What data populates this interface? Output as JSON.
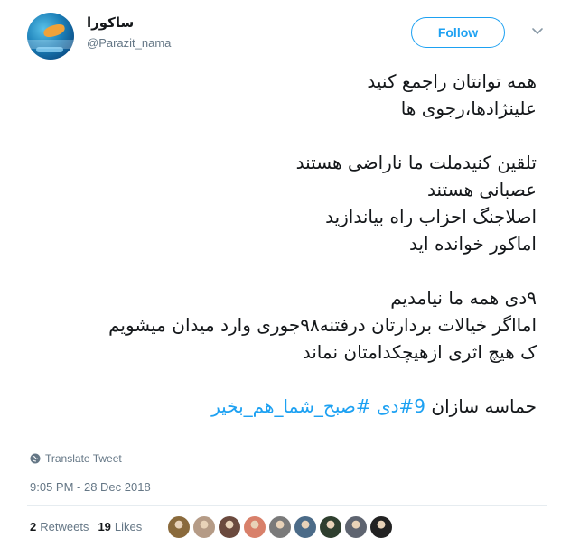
{
  "user": {
    "display_name": "ساکورا",
    "handle": "@Parazit_nama"
  },
  "header": {
    "follow_label": "Follow"
  },
  "tweet": {
    "lines": [
      "همه توانتان راجمع کنید",
      "علینژادها،رجوی ها",
      "",
      "تلقین کنیدملت ما ناراضی هستند",
      " عصبانی هستند",
      "اصلاجنگ احزاب راه بیاندازید",
      "اماکور خوانده اید",
      "",
      "۹دی همه ما نیامدیم",
      "امااگر خیالات بردارتان درفتنه۹۸جوری وارد میدان میشویم",
      "ک هیچ اثری ازهیچکدامتان نماند",
      ""
    ],
    "last_line_text": "حماسه سازان ",
    "hashtag_1": "9#دی",
    "hashtag_2": "#صبح_شما_هم_بخیر",
    "translate_label": "Translate Tweet",
    "timestamp": "9:05 PM - 28 Dec 2018"
  },
  "stats": {
    "retweets_count": "2",
    "retweets_label": "Retweets",
    "likes_count": "19",
    "likes_label": "Likes"
  },
  "likers": [
    {
      "name": "liker-1",
      "color": "#8a6a3c"
    },
    {
      "name": "liker-2",
      "color": "#b59b86"
    },
    {
      "name": "liker-3",
      "color": "#6b4a3e"
    },
    {
      "name": "liker-4",
      "color": "#d8806a"
    },
    {
      "name": "liker-5",
      "color": "#7a7a7a"
    },
    {
      "name": "liker-6",
      "color": "#4b6b88"
    },
    {
      "name": "liker-7",
      "color": "#2f3f2f"
    },
    {
      "name": "liker-8",
      "color": "#5e6470"
    },
    {
      "name": "liker-9",
      "color": "#222222"
    }
  ],
  "colors": {
    "accent": "#1da1f2",
    "muted": "#657786",
    "text": "#14171a"
  }
}
